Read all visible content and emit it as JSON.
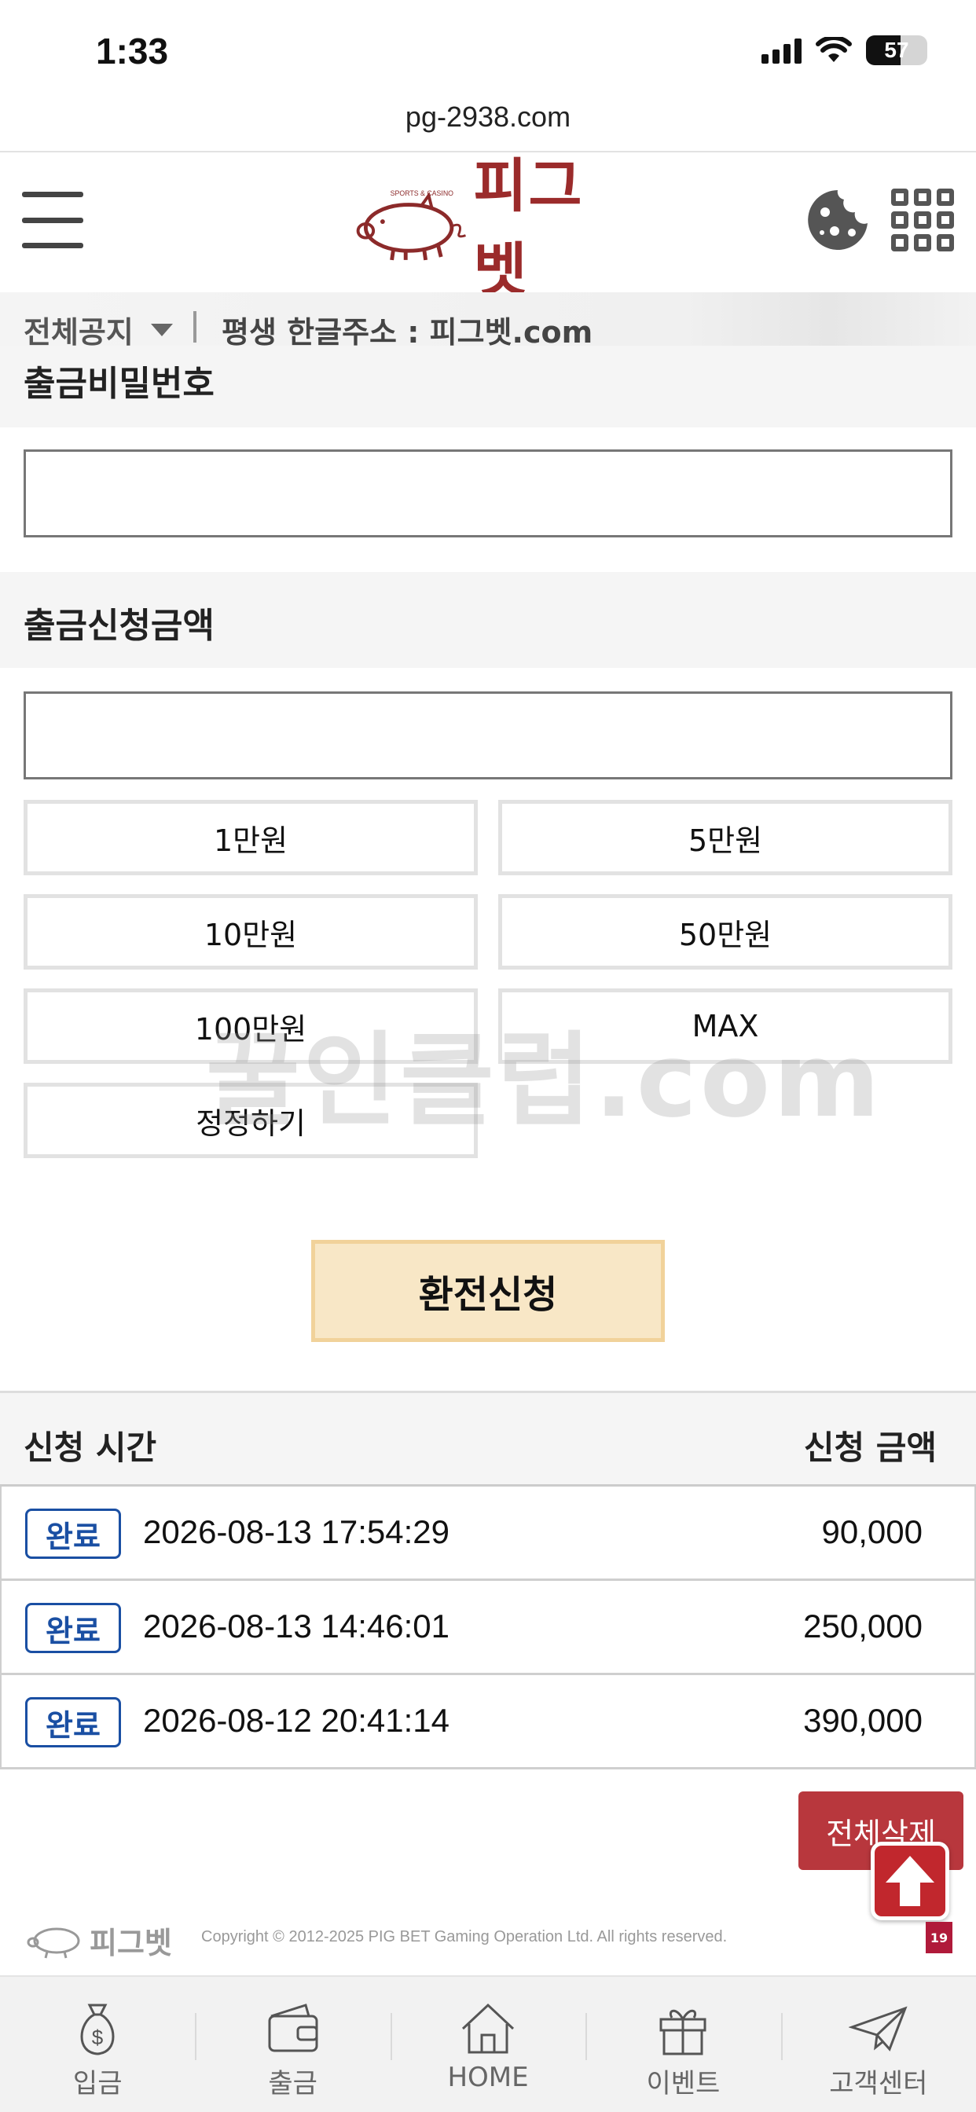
{
  "status": {
    "time": "1:33",
    "battery": "57",
    "battery_level": 0.57
  },
  "browser": {
    "url": "pg-2938.com"
  },
  "header": {
    "logo_text": "피그벳",
    "logo_small_text": "SPORTS & CASINO"
  },
  "notice": {
    "label": "전체공지",
    "text": "평생 한글주소 : 피그벳.com"
  },
  "withdraw_password": {
    "label": "출금비밀번호",
    "value": ""
  },
  "withdraw_amount": {
    "label": "출금신청금액",
    "value": "",
    "quick_buttons": [
      "1만원",
      "5만원",
      "10만원",
      "50만원",
      "100만원",
      "MAX",
      "정정하기"
    ]
  },
  "watermark": "꿀인클럽.com",
  "submit_label": "환전신청",
  "history": {
    "col_time": "신청 시간",
    "col_amount": "신청 금액",
    "rows": [
      {
        "status": "완료",
        "time": "2026-08-13 17:54:29",
        "amount": "90,000"
      },
      {
        "status": "완료",
        "time": "2026-08-13 14:46:01",
        "amount": "250,000"
      },
      {
        "status": "완료",
        "time": "2026-08-12 20:41:14",
        "amount": "390,000"
      }
    ]
  },
  "delete_all_label": "전체삭제",
  "footer": {
    "logo_text": "피그벳",
    "copyright": "Copyright © 2012-2025 PIG BET Gaming Operation Ltd. All rights reserved.",
    "age_badge": "19"
  },
  "nav": [
    {
      "label": "입금",
      "icon": "money-bag-icon"
    },
    {
      "label": "출금",
      "icon": "wallet-icon"
    },
    {
      "label": "HOME",
      "icon": "home-icon"
    },
    {
      "label": "이벤트",
      "icon": "gift-icon"
    },
    {
      "label": "고객센터",
      "icon": "paper-plane-icon"
    }
  ],
  "colors": {
    "brand": "#9b2b2b",
    "badge": "#1a4fa3",
    "submit_bg": "#f8e7c6",
    "delete_bg": "#b8373d"
  }
}
